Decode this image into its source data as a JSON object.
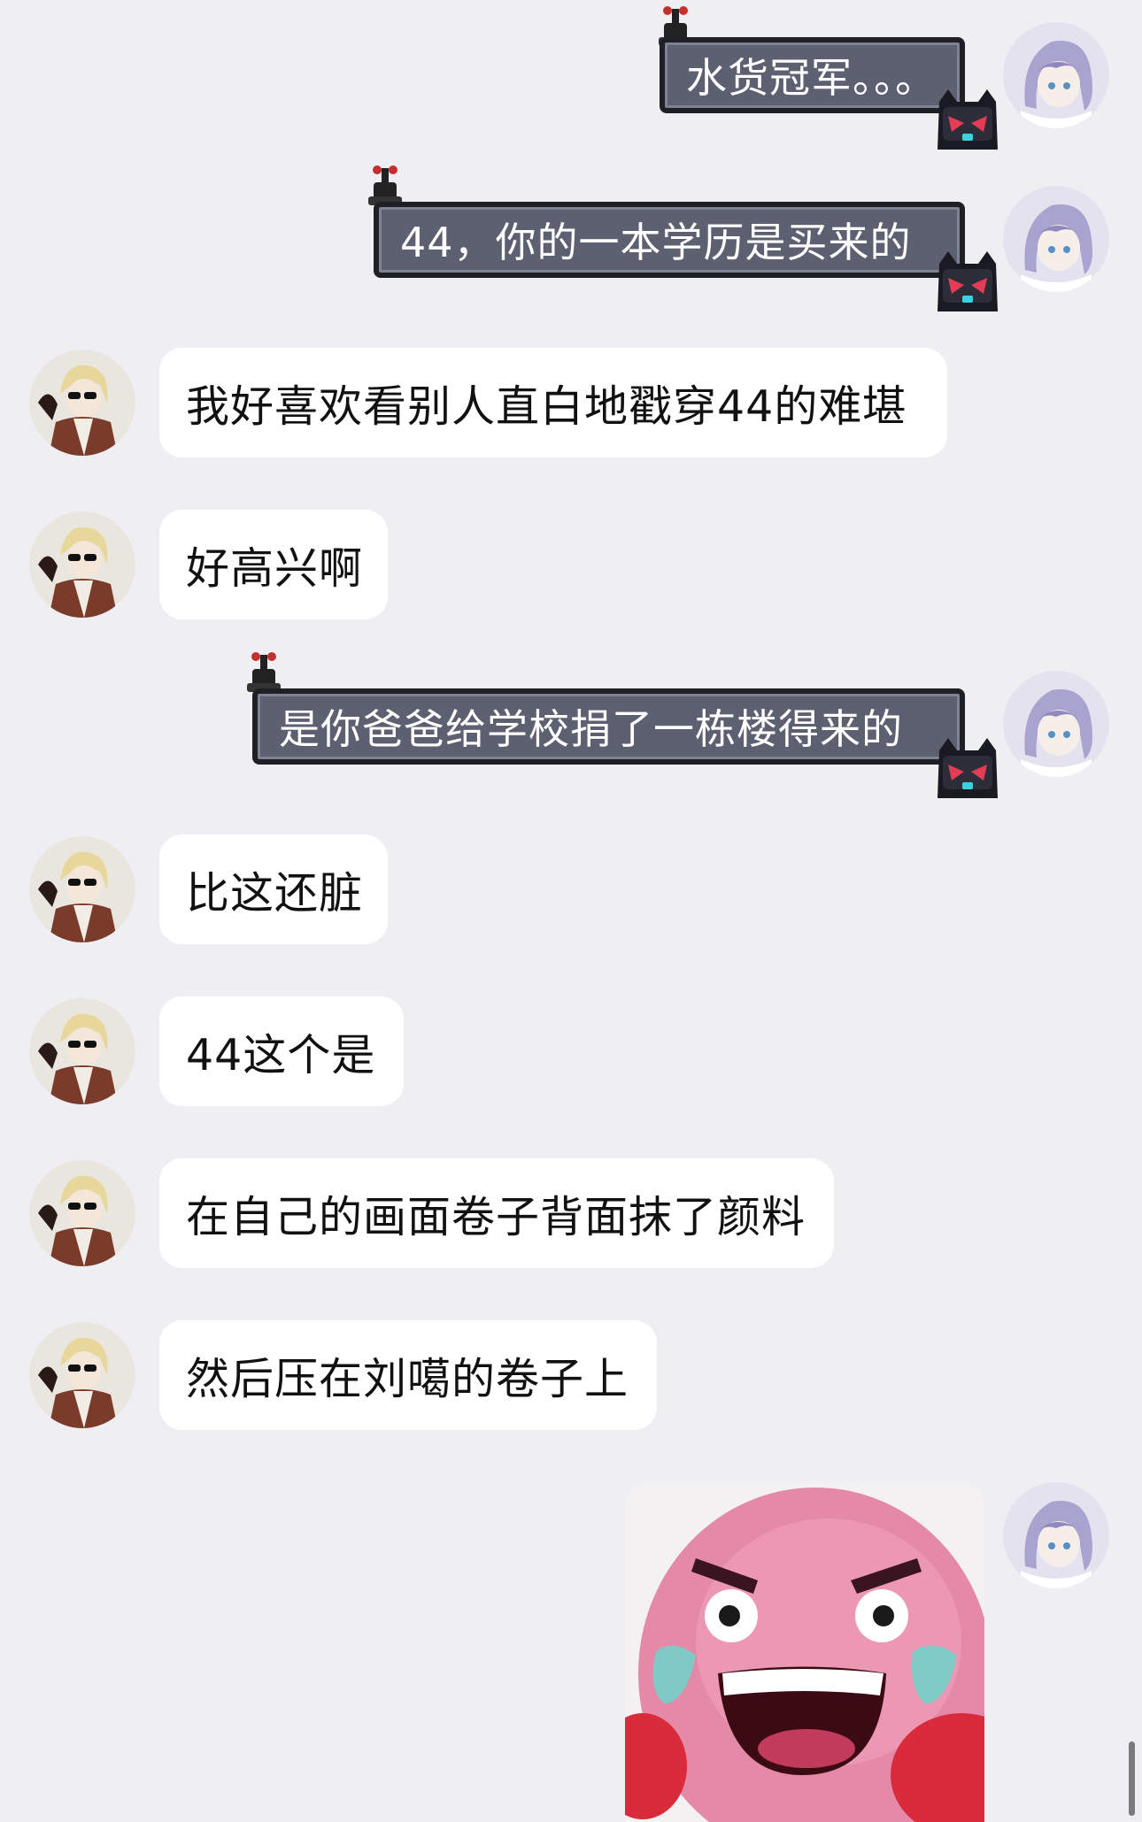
{
  "chat": {
    "messages": [
      {
        "side": "right",
        "style": "dark",
        "text": "水货冠军。。。"
      },
      {
        "side": "right",
        "style": "dark",
        "text": "44，你的一本学历是买来的"
      },
      {
        "side": "left",
        "style": "plain",
        "text": "我好喜欢看别人直白地戳穿44的难堪"
      },
      {
        "side": "left",
        "style": "plain",
        "text": "好高兴啊"
      },
      {
        "side": "right",
        "style": "dark",
        "text": "是你爸爸给学校捐了一栋楼得来的"
      },
      {
        "side": "left",
        "style": "plain",
        "text": "比这还脏"
      },
      {
        "side": "left",
        "style": "plain",
        "text": "44这个是"
      },
      {
        "side": "left",
        "style": "plain",
        "text": "在自己的画面卷子背面抹了颜料"
      },
      {
        "side": "left",
        "style": "plain",
        "text": "然后压在刘噶的卷子上"
      },
      {
        "side": "right",
        "style": "sticker",
        "sticker": "pink-angry-crying-face-sticker"
      }
    ]
  },
  "colors": {
    "background": "#efeff3",
    "bubble_plain": "#ffffff",
    "bubble_dark": "#5c6070",
    "bubble_dark_border": "#1f2026"
  }
}
